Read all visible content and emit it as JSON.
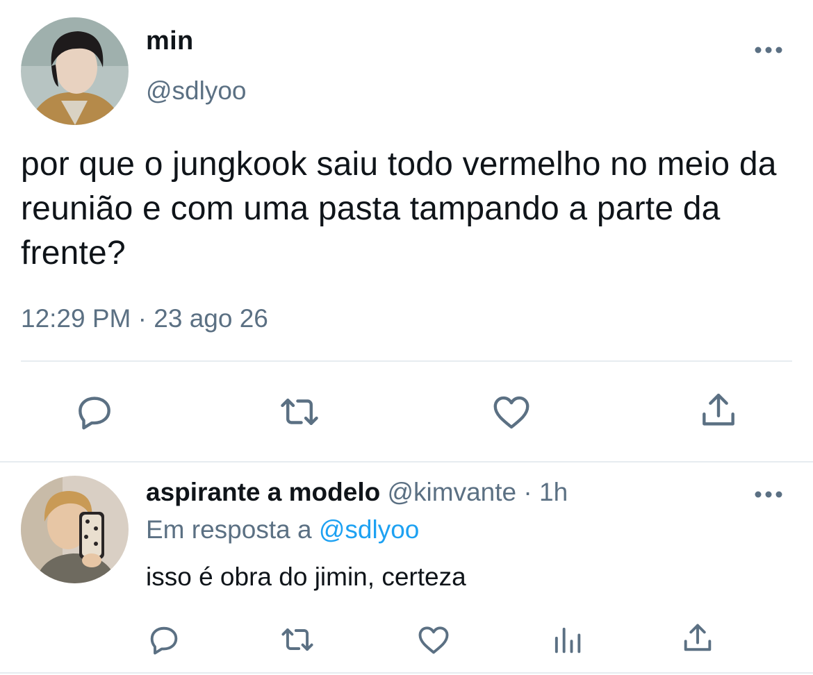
{
  "main_tweet": {
    "avatar": "profile-photo",
    "name": "min",
    "handle": "@sdlyoo",
    "text": "por que o jungkook saiu todo vermelho no meio da reunião e com uma pasta tampando a parte da frente?",
    "time": "12:29 PM",
    "separator": "·",
    "date": "23 ago 26",
    "actions": [
      "reply-icon",
      "retweet-icon",
      "like-icon",
      "share-icon"
    ]
  },
  "reply": {
    "avatar": "profile-photo",
    "name": "aspirante a modelo",
    "handle": "@kimvante",
    "separator": "·",
    "time": "1h",
    "context_prefix": "Em resposta a",
    "mention": "@sdlyoo",
    "text": "isso é obra do jimin, certeza",
    "actions": [
      "reply-icon",
      "retweet-icon",
      "like-icon",
      "analytics-icon",
      "share-icon"
    ]
  },
  "colors": {
    "text": "#0f1419",
    "muted": "#5b7083",
    "link": "#1da1f2",
    "divider": "#e6ecf0"
  }
}
